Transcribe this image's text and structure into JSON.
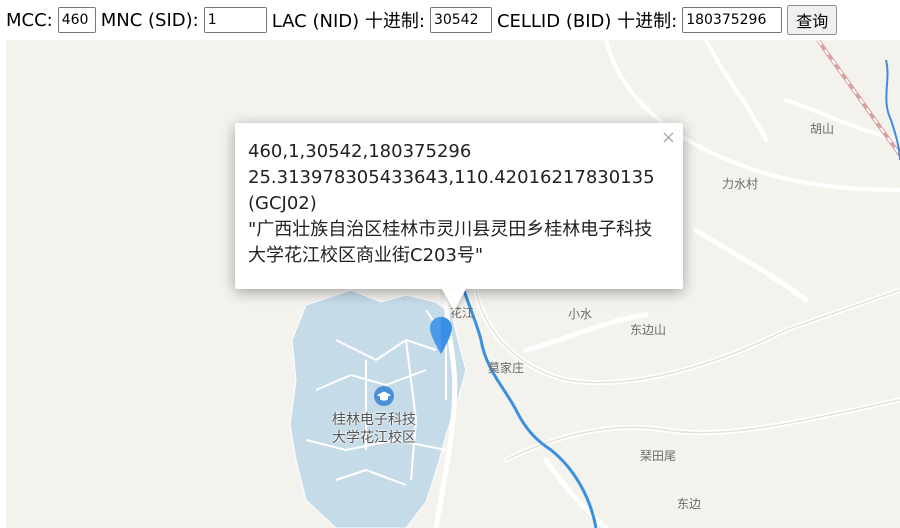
{
  "form": {
    "mcc_label": "MCC:",
    "mcc_value": "460",
    "mnc_label": "MNC (SID):",
    "mnc_value": "1",
    "lac_label": "LAC (NID) 十进制:",
    "lac_value": "30542",
    "cellid_label": "CELLID (BID) 十进制:",
    "cellid_value": "180375296",
    "query_button": "查询"
  },
  "popup": {
    "line1": "460,1,30542,180375296",
    "line2": "25.313978305433643,110.42016217830135",
    "line3": "(GCJ02)",
    "address": "\"广西壮族自治区桂林市灵川县灵田乡桂林电子科技大学花江校区商业街C203号\"",
    "close_glyph": "×"
  },
  "map": {
    "labels": {
      "hushan": "胡山",
      "lishuicun": "力水村",
      "huajiang": "花江",
      "xiaoshui": "小水",
      "dongbianshan": "东边山",
      "mojiazhuang": "莫家庄",
      "campus_line1": "桂林电子科技",
      "campus_line2": "大学花江校区",
      "qintianwei": "琹田尾",
      "dongbian": "东边"
    },
    "colors": {
      "land": "#f4f2ed",
      "campus_area": "#c6dbe8",
      "river": "#3a8fe0",
      "marker": "#3b8ee6",
      "railway": "#d9a0a0"
    },
    "icons": {
      "marker": "map-pin-icon",
      "campus": "graduation-cap-icon"
    }
  }
}
